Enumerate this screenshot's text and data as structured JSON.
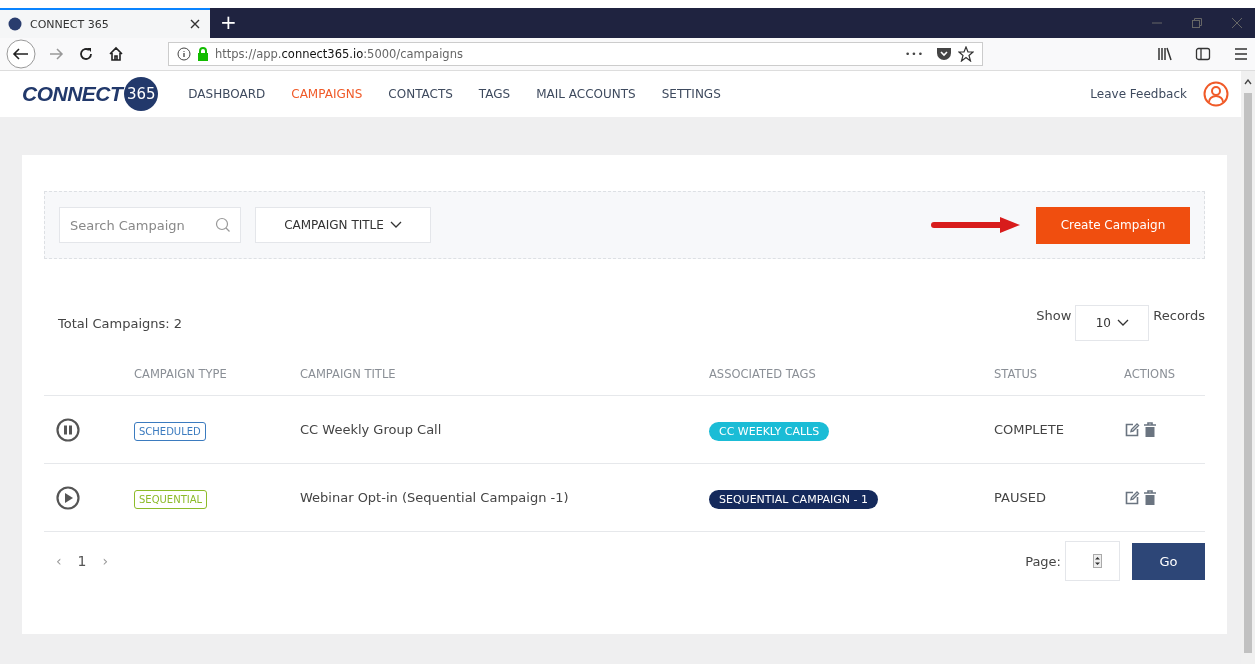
{
  "browser": {
    "tab_title": "CONNECT 365",
    "new_tab": "+",
    "url_prefix": "https://app.",
    "url_host": "connect365.io",
    "url_suffix": ":5000/campaigns",
    "more": "•••"
  },
  "logo": {
    "word": "CONNECT",
    "number": "365"
  },
  "nav": [
    {
      "label": "DASHBOARD",
      "selected": false
    },
    {
      "label": "CAMPAIGNS",
      "selected": true
    },
    {
      "label": "CONTACTS",
      "selected": false
    },
    {
      "label": "TAGS",
      "selected": false
    },
    {
      "label": "MAIL ACCOUNTS",
      "selected": false
    },
    {
      "label": "SETTINGS",
      "selected": false
    }
  ],
  "feedback_link": "Leave Feedback",
  "search": {
    "placeholder": "Search Campaign"
  },
  "sort_dropdown": "CAMPAIGN TITLE",
  "create_button": "Create Campaign",
  "total": "Total Campaigns: 2",
  "show": {
    "label": "Show",
    "value": "10",
    "suffix": "Records"
  },
  "table": {
    "columns": [
      "CAMPAIGN TYPE",
      "CAMPAIGN TITLE",
      "ASSOCIATED TAGS",
      "STATUS",
      "ACTIONS"
    ],
    "rows": [
      {
        "running": true,
        "type": {
          "text": "SCHEDULED",
          "color": "#3b7bbf"
        },
        "title": "CC Weekly Group Call",
        "tag": {
          "text": "CC WEEKLY CALLS",
          "color": "#1bbcd6"
        },
        "status": "COMPLETE"
      },
      {
        "running": false,
        "type": {
          "text": "SEQUENTIAL",
          "color": "#8dbb2a"
        },
        "title": "Webinar Opt-in (Sequential Campaign -1)",
        "tag": {
          "text": "SEQUENTIAL CAMPAIGN - 1",
          "color": "#152a5c"
        },
        "status": "PAUSED"
      }
    ]
  },
  "pager": {
    "prev": "‹",
    "page": "1",
    "next": "›",
    "page_label": "Page:",
    "go": "Go"
  }
}
